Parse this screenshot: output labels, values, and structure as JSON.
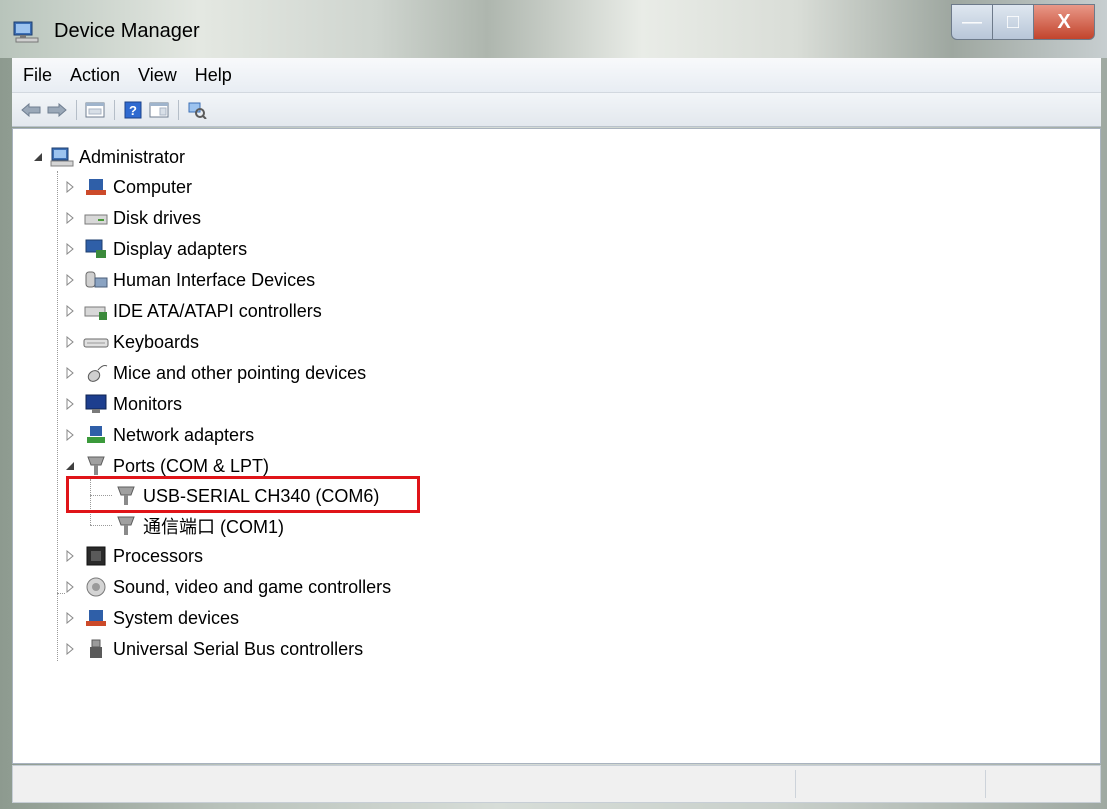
{
  "window": {
    "title": "Device Manager",
    "controls": {
      "minimize": "—",
      "maximize": "□",
      "close": "X"
    }
  },
  "menu": [
    "File",
    "Action",
    "View",
    "Help"
  ],
  "toolbar": [
    "back-icon",
    "forward-icon",
    "properties-icon",
    "help-icon",
    "show-hidden-icon",
    "scan-hardware-icon"
  ],
  "tree": {
    "root": "Administrator",
    "categories": [
      "Computer",
      "Disk drives",
      "Display adapters",
      "Human Interface Devices",
      "IDE ATA/ATAPI controllers",
      "Keyboards",
      "Mice and other pointing devices",
      "Monitors",
      "Network adapters",
      "Ports (COM & LPT)",
      "Processors",
      "Sound, video and game controllers",
      "System devices",
      "Universal Serial Bus controllers"
    ],
    "ports": [
      "USB-SERIAL CH340 (COM6)",
      "通信端口 (COM1)"
    ]
  },
  "colors": {
    "highlight": "#e01418"
  }
}
